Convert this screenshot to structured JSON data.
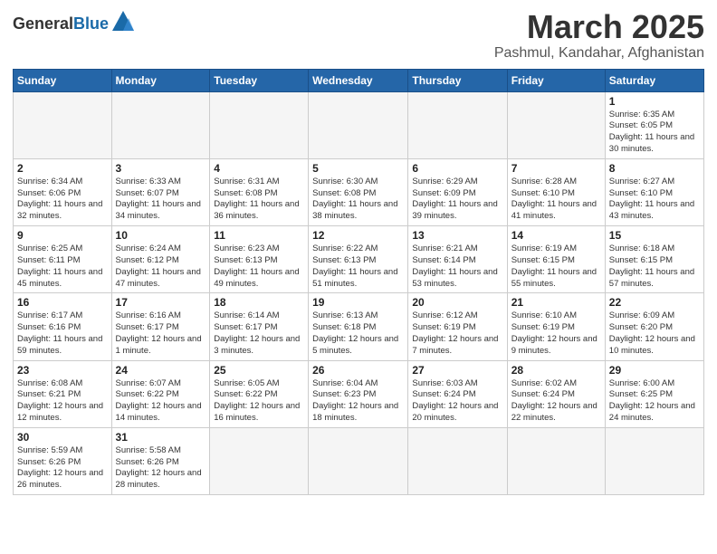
{
  "header": {
    "logo_general": "General",
    "logo_blue": "Blue",
    "month_title": "March 2025",
    "subtitle": "Pashmul, Kandahar, Afghanistan"
  },
  "weekdays": [
    "Sunday",
    "Monday",
    "Tuesday",
    "Wednesday",
    "Thursday",
    "Friday",
    "Saturday"
  ],
  "weeks": [
    [
      {
        "day": "",
        "empty": true
      },
      {
        "day": "",
        "empty": true
      },
      {
        "day": "",
        "empty": true
      },
      {
        "day": "",
        "empty": true
      },
      {
        "day": "",
        "empty": true
      },
      {
        "day": "",
        "empty": true
      },
      {
        "day": "1",
        "sunrise": "6:35 AM",
        "sunset": "6:05 PM",
        "daylight": "11 hours and 30 minutes."
      }
    ],
    [
      {
        "day": "2",
        "sunrise": "6:34 AM",
        "sunset": "6:06 PM",
        "daylight": "11 hours and 32 minutes."
      },
      {
        "day": "3",
        "sunrise": "6:33 AM",
        "sunset": "6:07 PM",
        "daylight": "11 hours and 34 minutes."
      },
      {
        "day": "4",
        "sunrise": "6:31 AM",
        "sunset": "6:08 PM",
        "daylight": "11 hours and 36 minutes."
      },
      {
        "day": "5",
        "sunrise": "6:30 AM",
        "sunset": "6:08 PM",
        "daylight": "11 hours and 38 minutes."
      },
      {
        "day": "6",
        "sunrise": "6:29 AM",
        "sunset": "6:09 PM",
        "daylight": "11 hours and 39 minutes."
      },
      {
        "day": "7",
        "sunrise": "6:28 AM",
        "sunset": "6:10 PM",
        "daylight": "11 hours and 41 minutes."
      },
      {
        "day": "8",
        "sunrise": "6:27 AM",
        "sunset": "6:10 PM",
        "daylight": "11 hours and 43 minutes."
      }
    ],
    [
      {
        "day": "9",
        "sunrise": "6:25 AM",
        "sunset": "6:11 PM",
        "daylight": "11 hours and 45 minutes."
      },
      {
        "day": "10",
        "sunrise": "6:24 AM",
        "sunset": "6:12 PM",
        "daylight": "11 hours and 47 minutes."
      },
      {
        "day": "11",
        "sunrise": "6:23 AM",
        "sunset": "6:13 PM",
        "daylight": "11 hours and 49 minutes."
      },
      {
        "day": "12",
        "sunrise": "6:22 AM",
        "sunset": "6:13 PM",
        "daylight": "11 hours and 51 minutes."
      },
      {
        "day": "13",
        "sunrise": "6:21 AM",
        "sunset": "6:14 PM",
        "daylight": "11 hours and 53 minutes."
      },
      {
        "day": "14",
        "sunrise": "6:19 AM",
        "sunset": "6:15 PM",
        "daylight": "11 hours and 55 minutes."
      },
      {
        "day": "15",
        "sunrise": "6:18 AM",
        "sunset": "6:15 PM",
        "daylight": "11 hours and 57 minutes."
      }
    ],
    [
      {
        "day": "16",
        "sunrise": "6:17 AM",
        "sunset": "6:16 PM",
        "daylight": "11 hours and 59 minutes."
      },
      {
        "day": "17",
        "sunrise": "6:16 AM",
        "sunset": "6:17 PM",
        "daylight": "12 hours and 1 minute."
      },
      {
        "day": "18",
        "sunrise": "6:14 AM",
        "sunset": "6:17 PM",
        "daylight": "12 hours and 3 minutes."
      },
      {
        "day": "19",
        "sunrise": "6:13 AM",
        "sunset": "6:18 PM",
        "daylight": "12 hours and 5 minutes."
      },
      {
        "day": "20",
        "sunrise": "6:12 AM",
        "sunset": "6:19 PM",
        "daylight": "12 hours and 7 minutes."
      },
      {
        "day": "21",
        "sunrise": "6:10 AM",
        "sunset": "6:19 PM",
        "daylight": "12 hours and 9 minutes."
      },
      {
        "day": "22",
        "sunrise": "6:09 AM",
        "sunset": "6:20 PM",
        "daylight": "12 hours and 10 minutes."
      }
    ],
    [
      {
        "day": "23",
        "sunrise": "6:08 AM",
        "sunset": "6:21 PM",
        "daylight": "12 hours and 12 minutes."
      },
      {
        "day": "24",
        "sunrise": "6:07 AM",
        "sunset": "6:22 PM",
        "daylight": "12 hours and 14 minutes."
      },
      {
        "day": "25",
        "sunrise": "6:05 AM",
        "sunset": "6:22 PM",
        "daylight": "12 hours and 16 minutes."
      },
      {
        "day": "26",
        "sunrise": "6:04 AM",
        "sunset": "6:23 PM",
        "daylight": "12 hours and 18 minutes."
      },
      {
        "day": "27",
        "sunrise": "6:03 AM",
        "sunset": "6:24 PM",
        "daylight": "12 hours and 20 minutes."
      },
      {
        "day": "28",
        "sunrise": "6:02 AM",
        "sunset": "6:24 PM",
        "daylight": "12 hours and 22 minutes."
      },
      {
        "day": "29",
        "sunrise": "6:00 AM",
        "sunset": "6:25 PM",
        "daylight": "12 hours and 24 minutes."
      }
    ],
    [
      {
        "day": "30",
        "sunrise": "5:59 AM",
        "sunset": "6:26 PM",
        "daylight": "12 hours and 26 minutes."
      },
      {
        "day": "31",
        "sunrise": "5:58 AM",
        "sunset": "6:26 PM",
        "daylight": "12 hours and 28 minutes."
      },
      {
        "day": "",
        "empty": true
      },
      {
        "day": "",
        "empty": true
      },
      {
        "day": "",
        "empty": true
      },
      {
        "day": "",
        "empty": true
      },
      {
        "day": "",
        "empty": true
      }
    ]
  ]
}
